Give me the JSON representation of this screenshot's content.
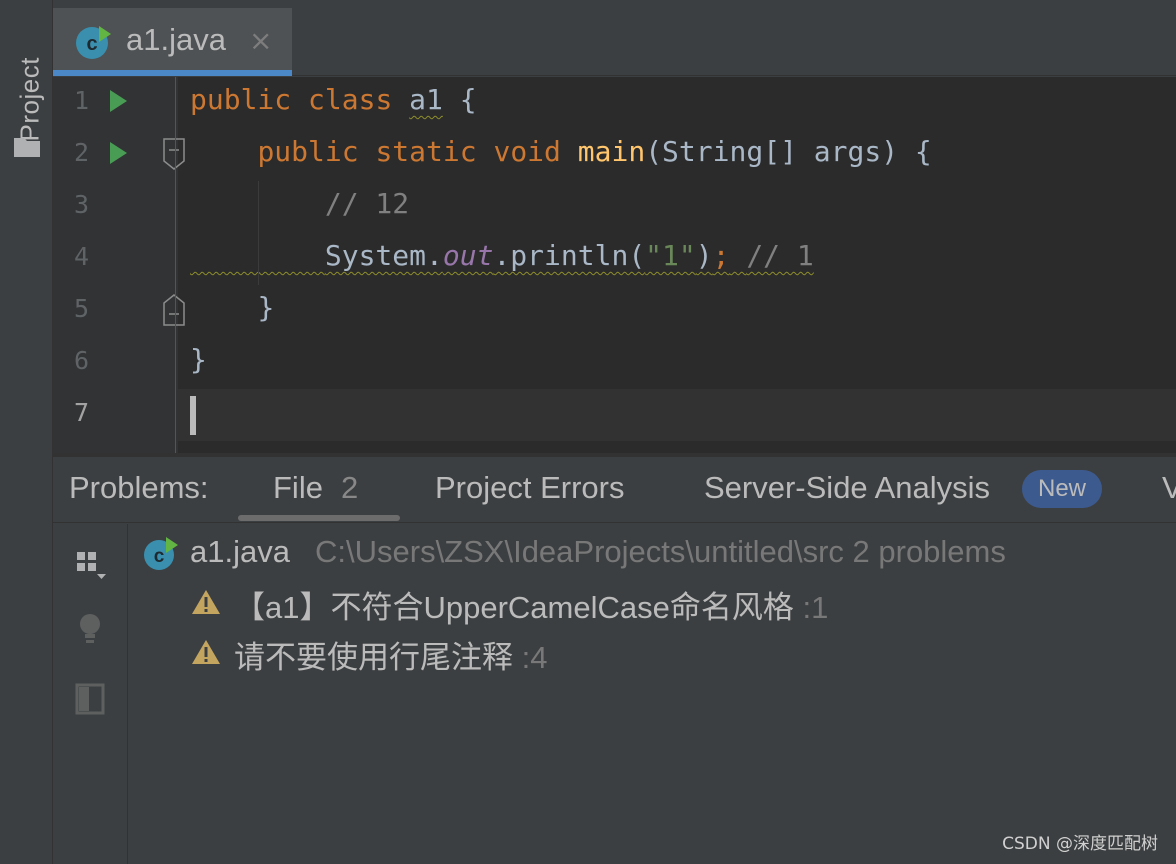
{
  "sidebar": {
    "project_label": "Project"
  },
  "tab": {
    "filename": "a1.java",
    "close_glyph": "×"
  },
  "editor": {
    "lines": [
      {
        "num": "1",
        "run": true
      },
      {
        "num": "2",
        "run": true
      },
      {
        "num": "3",
        "run": false
      },
      {
        "num": "4",
        "run": false
      },
      {
        "num": "5",
        "run": false
      },
      {
        "num": "6",
        "run": false
      },
      {
        "num": "7",
        "run": false
      }
    ],
    "code": {
      "l1_public": "public",
      "l1_class": "class",
      "l1_name": "a1",
      "l1_brace": "{",
      "l2_public": "public",
      "l2_static": "static",
      "l2_void": "void",
      "l2_main": "main",
      "l2_params": "(String[] args) {",
      "l3_comment": "// 12",
      "l4_system": "System.",
      "l4_out": "out",
      "l4_println": ".println(",
      "l4_string": "\"1\"",
      "l4_close": ")",
      "l4_semicolon": ";",
      "l4_comment": "// 1",
      "l5_brace": "}",
      "l6_brace": "}"
    }
  },
  "problems": {
    "title": "Problems:",
    "tabs": {
      "file_label": "File",
      "file_count": "2",
      "project_errors": "Project Errors",
      "server_side": "Server-Side Analysis",
      "new_badge": "New",
      "more": "V"
    },
    "file": {
      "name": "a1.java",
      "path": "C:\\Users\\ZSX\\IdeaProjects\\untitled\\src  2 problems"
    },
    "items": [
      {
        "text": "【a1】不符合UpperCamelCase命名风格",
        "line": ":1"
      },
      {
        "text": "请不要使用行尾注释",
        "line": ":4"
      }
    ]
  },
  "watermark": "CSDN @深度匹配树",
  "colors": {
    "keyword": "#cc7832",
    "function": "#ffc66d",
    "comment": "#808080",
    "string": "#6a8759",
    "field": "#9876aa",
    "accent": "#4a88c7",
    "run_green": "#499c54",
    "warning": "#c4a560"
  }
}
